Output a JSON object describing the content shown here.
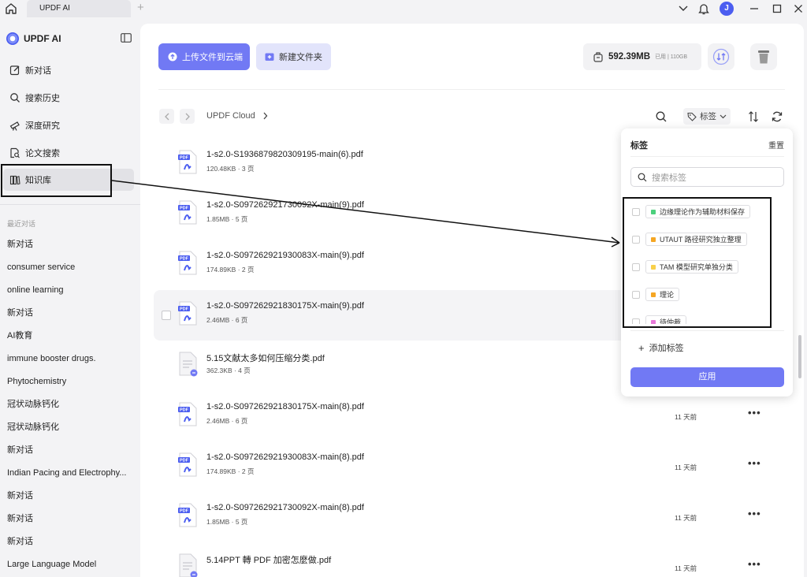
{
  "titlebar": {
    "tab_label": "UPDF AI",
    "avatar_initial": "J"
  },
  "sidebar": {
    "brand": "UPDF AI",
    "nav": [
      {
        "label": "新对话",
        "icon": "edit-icon"
      },
      {
        "label": "搜索历史",
        "icon": "search-icon"
      },
      {
        "label": "深度研究",
        "icon": "telescope-icon"
      },
      {
        "label": "论文搜索",
        "icon": "doc-search-icon"
      },
      {
        "label": "知识库",
        "icon": "library-icon",
        "active": true
      }
    ],
    "recent_label": "最近对话",
    "recent": [
      "新对话",
      "consumer service",
      "online learning",
      "新对话",
      "AI教育",
      "immune booster drugs.",
      "Phytochemistry",
      "冠状动脉钙化",
      "冠状动脉钙化",
      "新对话",
      "Indian Pacing and Electrophy...",
      "新对话",
      "新对话",
      "新对话",
      "Large Language Model"
    ]
  },
  "toolbar": {
    "upload_label": "上传文件到云端",
    "new_folder_label": "新建文件夹",
    "storage_used": "592.39MB",
    "storage_total": "已用 | 110GB"
  },
  "breadcrumb": {
    "root": "UPDF Cloud"
  },
  "filter": {
    "tag_label": "标签"
  },
  "files": [
    {
      "name": "1-s2.0-S1936879820309195-main(6).pdf",
      "meta": "120.48KB · 3 页",
      "time": "",
      "type": "pdf"
    },
    {
      "name": "1-s2.0-S097262921730092X-main(9).pdf",
      "meta": "1.85MB · 5 页",
      "time": "",
      "type": "pdf"
    },
    {
      "name": "1-s2.0-S097262921930083X-main(9).pdf",
      "meta": "174.89KB · 2 页",
      "time": "",
      "type": "pdf"
    },
    {
      "name": "1-s2.0-S097262921830175X-main(9).pdf",
      "meta": "2.46MB · 6 页",
      "time": "",
      "type": "pdf",
      "hover": true
    },
    {
      "name": "5.15文献太多如何压缩分类.pdf",
      "meta": "362.3KB · 4 页",
      "time": "",
      "type": "doc"
    },
    {
      "name": "1-s2.0-S097262921830175X-main(8).pdf",
      "meta": "2.46MB · 6 页",
      "time": "11 天前",
      "type": "pdf"
    },
    {
      "name": "1-s2.0-S097262921930083X-main(8).pdf",
      "meta": "174.89KB · 2 页",
      "time": "11 天前",
      "type": "pdf"
    },
    {
      "name": "1-s2.0-S097262921730092X-main(8).pdf",
      "meta": "1.85MB · 5 页",
      "time": "11 天前",
      "type": "pdf"
    },
    {
      "name": "5.14PPT 轉 PDF 加密怎麼做.pdf",
      "meta": "",
      "time": "11 天前",
      "type": "doc"
    }
  ],
  "tag_popup": {
    "title": "标签",
    "reset": "重置",
    "search_placeholder": "搜索标签",
    "tags": [
      {
        "label": "边缘理论作为辅助材料保存",
        "color": "#4cd07d"
      },
      {
        "label": "UTAUT 路径研究独立整理",
        "color": "#f5a623"
      },
      {
        "label": "TAM 模型研究单独分类",
        "color": "#f8d04a"
      },
      {
        "label": "理论",
        "color": "#f5a623"
      },
      {
        "label": "待仲裁",
        "color": "#e879d9"
      }
    ],
    "add_label": "添加标签",
    "apply_label": "应用"
  }
}
